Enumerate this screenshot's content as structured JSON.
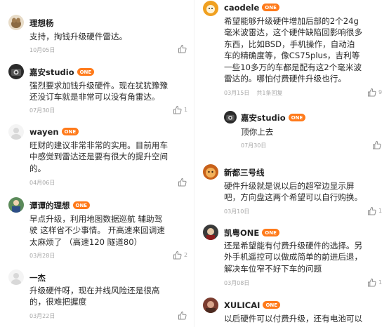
{
  "left_comments": [
    {
      "user": "理想杨",
      "badge": "",
      "text": "支持，掏钱升级硬件雷达。",
      "date": "10月05日",
      "replies": "",
      "likes": ""
    },
    {
      "user": "嘉安studio",
      "badge": "ONE",
      "text": "强烈要求加钱升级硬件。现在犹犹豫豫\n还没订车就是非常可以没有角雷达。",
      "date": "07月30日",
      "replies": "",
      "likes": "1"
    },
    {
      "user": "wayen",
      "badge": "ONE",
      "text": "旺财的建议非常非常的实用。目前用车\n中感觉到雷达还是要有很大的提升空间\n的。",
      "date": "04月06日",
      "replies": "",
      "likes": ""
    },
    {
      "user": "谭谭的理想",
      "badge": "ONE",
      "text": "早点升级，利用地图数据巡航  辅助驾\n驶 这样省不少事情。 开高速来回调速\n太麻烦了 （高速120 隧道80）",
      "date": "03月28日",
      "replies": "",
      "likes": "2"
    },
    {
      "user": "一杰",
      "badge": "",
      "text": "升级硬件呀，现在并线风险还是很高\n的，很难把握度",
      "date": "03月22日",
      "replies": "",
      "likes": ""
    }
  ],
  "right_comments": [
    {
      "user": "caodele",
      "badge": "ONE",
      "text": "希望能够升级硬件增加后部的2个24g\n毫米波雷达，这个硬件缺陷回影响很多\n东西，比如BSD，手机操作，自动泊\n车的精确度等，像CS75plus，吉利等\n一些10多万的车都是配有这2个毫米波\n雷达的。哪怕付费硬件升级也行。",
      "date": "03月15日",
      "replies": "共1条回复",
      "likes": "9"
    },
    {
      "user": "嘉安studio",
      "badge": "ONE",
      "text": "顶你上去",
      "date": "07月30日",
      "replies": "",
      "likes": ""
    },
    {
      "user": "新都三号线",
      "badge": "",
      "text": "硬件升级就是说以后的超窄边显示屏\n吧，方向盘这两个希望可以自行购换。",
      "date": "03月10日",
      "replies": "",
      "likes": "1"
    },
    {
      "user": "凯粤ONE",
      "badge": "ONE",
      "text": "还是希望能有付费升级硬件的选择。另\n外手机遥控可以做成简单的前进后退，\n解决车位窄不好下车的问题",
      "date": "03月08日",
      "replies": "",
      "likes": "1"
    },
    {
      "user": "XULICAI",
      "badge": "ONE",
      "text": "以后硬件可以付费升级，还有电池可以",
      "date": "",
      "replies": "",
      "likes": ""
    }
  ],
  "colors": {
    "badge": "#ff7a1a",
    "meta": "#a6a6a6",
    "text": "#2a2a2a"
  },
  "icons": {
    "like": "thumbs-up-icon"
  }
}
